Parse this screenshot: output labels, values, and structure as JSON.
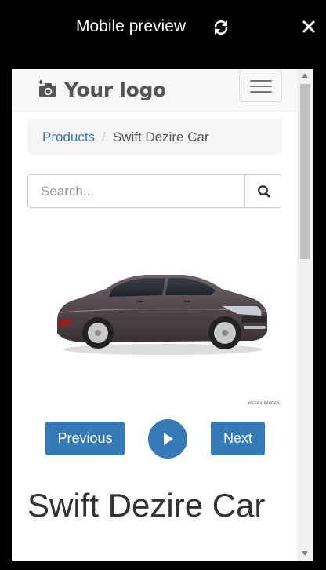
{
  "window": {
    "title": "Mobile preview",
    "refresh_icon": "refresh-icon",
    "close_icon": "close-icon"
  },
  "navbar": {
    "logo_icon": "camera-plus-icon",
    "logo_text": "Your logo",
    "menu_icon": "hamburger-icon"
  },
  "breadcrumb": {
    "link_label": "Products",
    "separator": "/",
    "current": "Swift Dezire Car"
  },
  "search": {
    "placeholder": "Search...",
    "value": "",
    "icon": "search-icon"
  },
  "product": {
    "image": "car-image",
    "watermark": "HEXAX IMAGES",
    "title": "Swift Dezire Car"
  },
  "controls": {
    "previous_label": "Previous",
    "play_icon": "play-icon",
    "next_label": "Next"
  },
  "colors": {
    "primary": "#337ab7",
    "link": "#337ab7",
    "window_bg": "#000000"
  }
}
